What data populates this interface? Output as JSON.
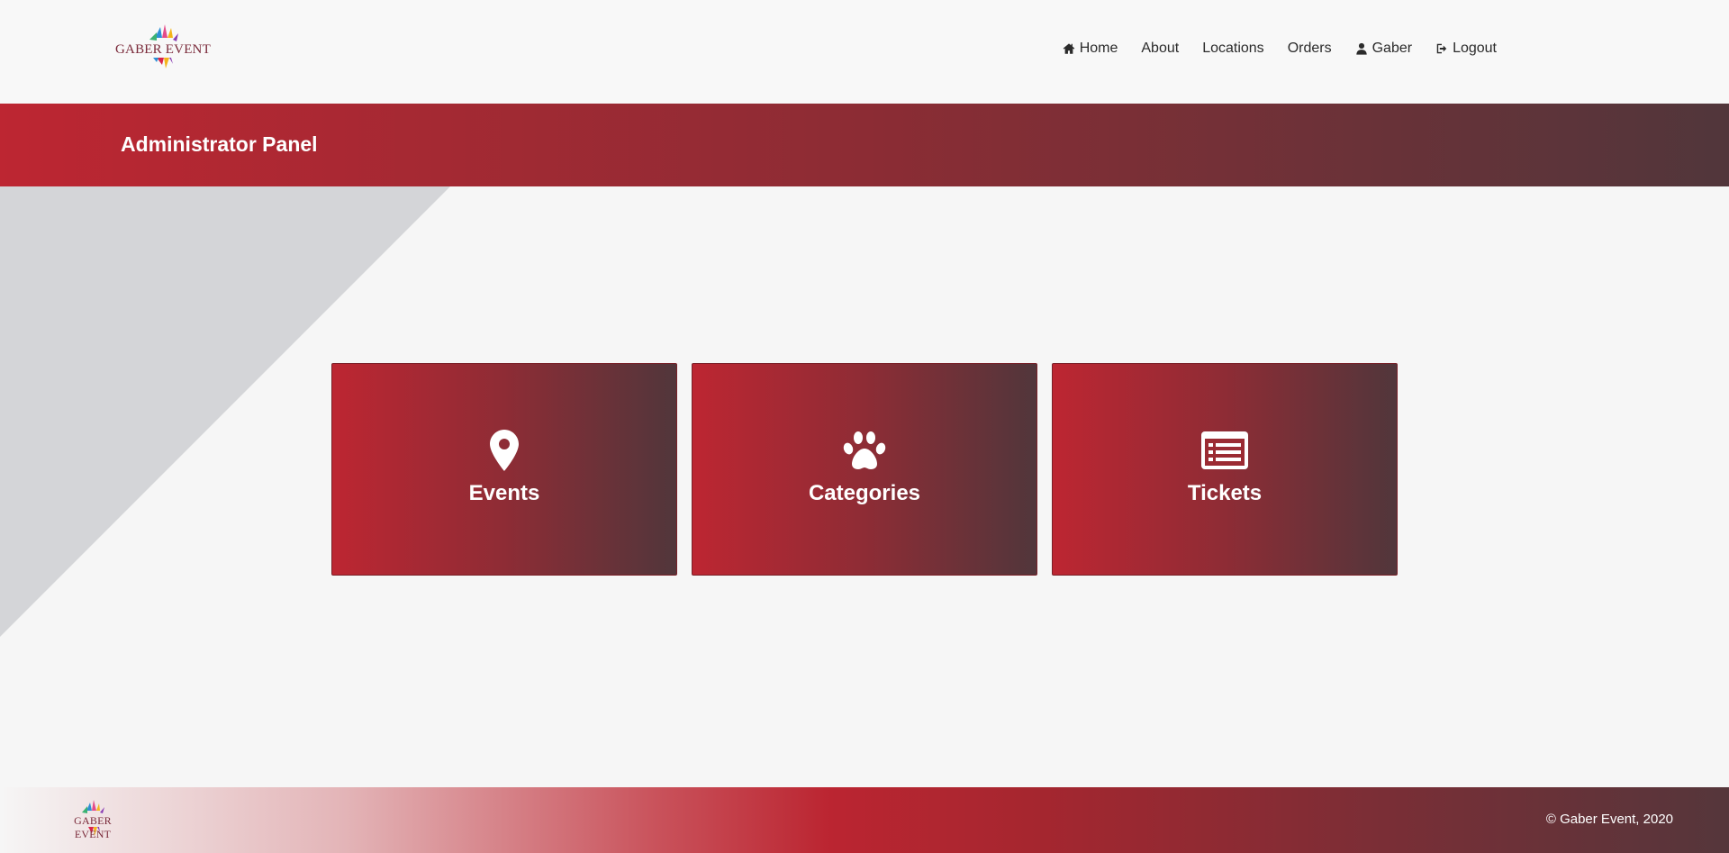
{
  "brand": {
    "logo_text": "GABER EVENT"
  },
  "nav": {
    "home": "Home",
    "about": "About",
    "locations": "Locations",
    "orders": "Orders",
    "user": "Gaber",
    "logout": "Logout"
  },
  "banner": {
    "title": "Administrator Panel"
  },
  "cards": [
    {
      "label": "Events",
      "icon": "map-marker-icon"
    },
    {
      "label": "Categories",
      "icon": "paw-icon"
    },
    {
      "label": "Tickets",
      "icon": "list-alt-icon"
    }
  ],
  "footer": {
    "logo_text": "GABER EVENT",
    "copyright": "© Gaber Event, 2020"
  },
  "colors": {
    "accent_red": "#bd2632",
    "accent_dark": "#51363b",
    "page_bg": "#f6f6f6",
    "triangle_grey": "#d4d5d8"
  }
}
